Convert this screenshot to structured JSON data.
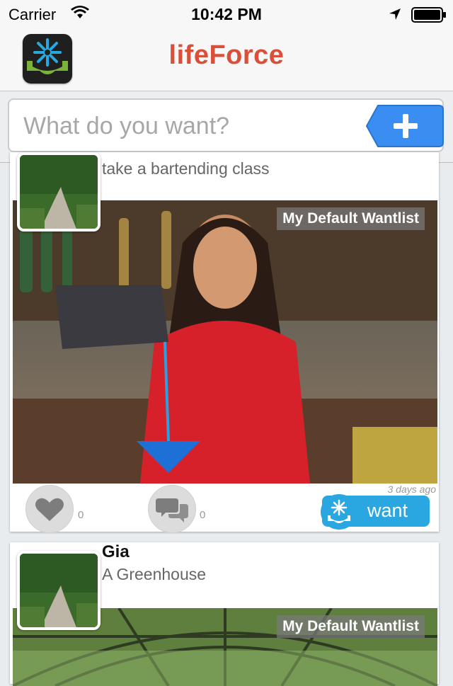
{
  "status_bar": {
    "carrier": "Carrier",
    "time": "10:42 PM"
  },
  "nav": {
    "title": "lifeForce"
  },
  "search": {
    "placeholder": "What do you want?",
    "value": ""
  },
  "feed": [
    {
      "user_name": "",
      "item_title": "take a bartending class",
      "wantlist": "My Default Wantlist",
      "time_ago": "3 days ago",
      "like_count": "0",
      "comment_count": "0",
      "want_label": "want"
    },
    {
      "user_name": "Gia",
      "item_title": "A Greenhouse",
      "wantlist": "My Default Wantlist"
    }
  ],
  "colors": {
    "brand_title": "#d8503a",
    "add_button": "#3a8ef2",
    "want_button": "#2aa6e0",
    "logo_green": "#7bb33a",
    "logo_blue": "#26a9e0"
  },
  "icons": [
    "wifi-icon",
    "location-arrow-icon",
    "battery-icon",
    "app-logo-icon",
    "plus-icon",
    "heart-icon",
    "comment-icon",
    "want-logo-icon"
  ]
}
